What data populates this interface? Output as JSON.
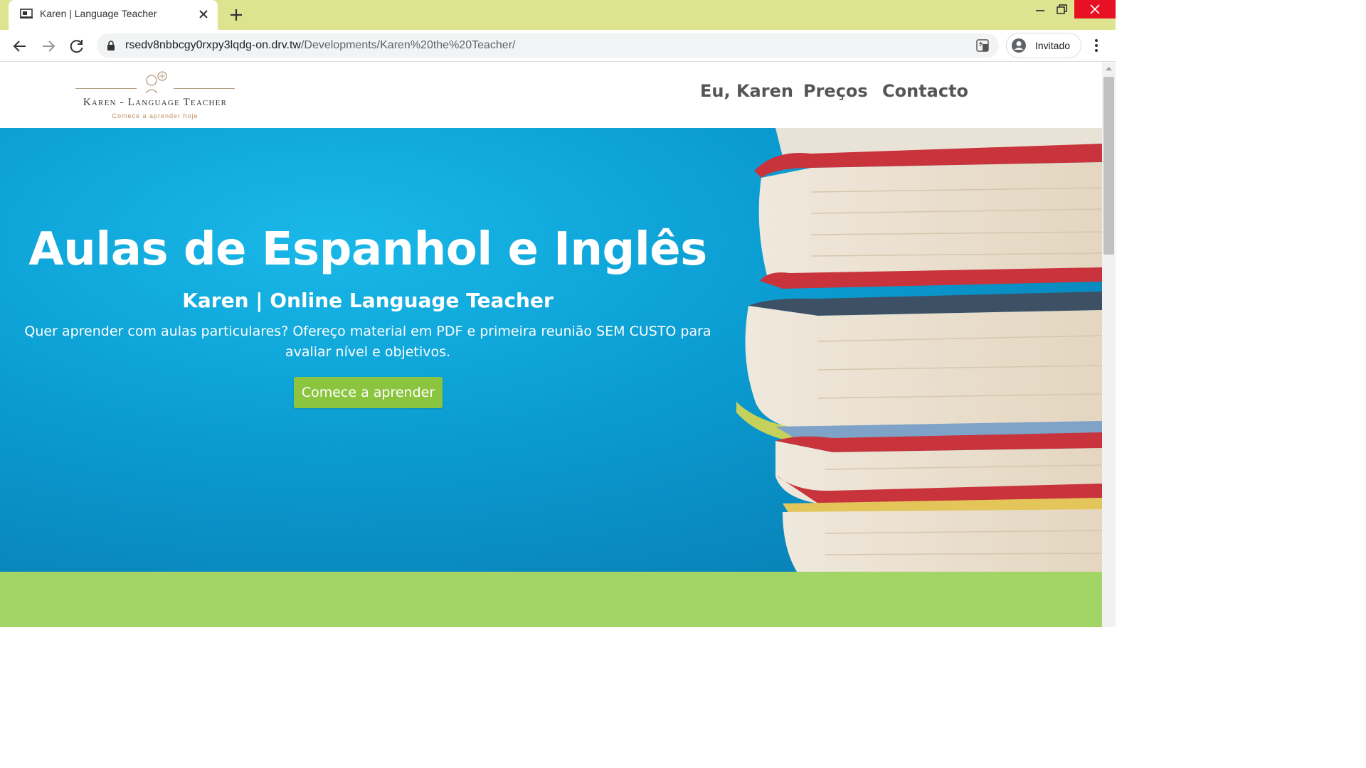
{
  "browser": {
    "tab_title": "Karen | Language Teacher",
    "url_host": "rsedv8nbbcgy0rxpy3lqdg-on.drv.tw",
    "url_path": "/Developments/Karen%20the%20Teacher/",
    "profile_label": "Invitado",
    "tabstrip_color": "#dde38e"
  },
  "site": {
    "logo": {
      "name": "Karen - Language Teacher",
      "tagline": "Comece a aprender hoje"
    },
    "nav": [
      {
        "label": "Eu, Karen"
      },
      {
        "label": "Preços"
      },
      {
        "label": "Contacto"
      }
    ],
    "hero": {
      "title": "Aulas de Espanhol e Inglês",
      "subtitle": "Karen | Online Language Teacher",
      "text": "Quer aprender com aulas particulares? Ofereço material em PDF e primeira reunião SEM CUSTO para avaliar nível e objetivos.",
      "cta_label": "Comece a aprender",
      "background_color": "#0a9bd0",
      "cta_color": "#8bc53f"
    },
    "band_color": "#a2d566"
  }
}
